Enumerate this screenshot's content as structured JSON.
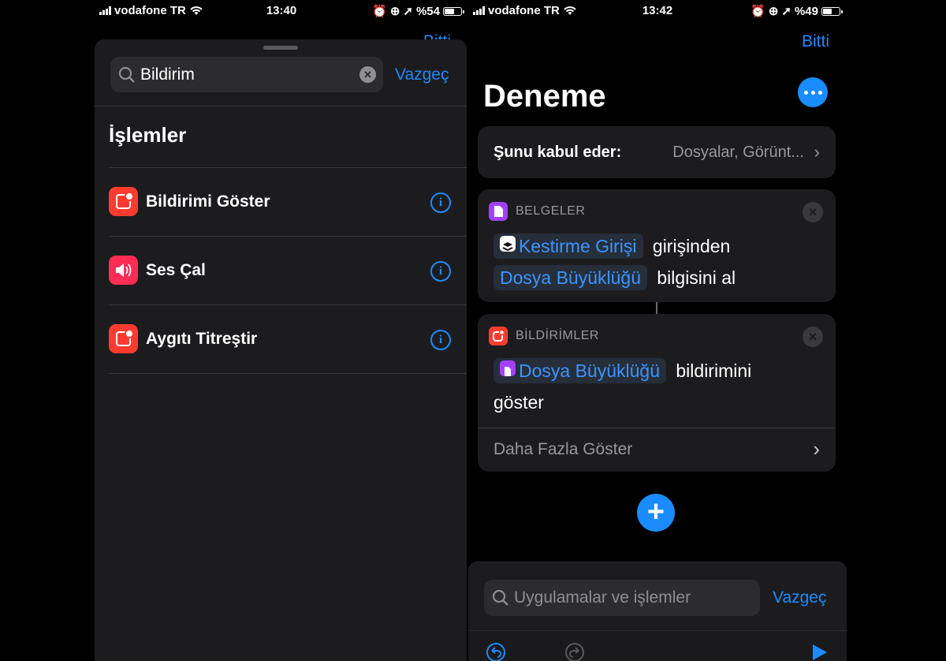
{
  "colors": {
    "accent": "#1a8cff",
    "notification_red": "#ff3b30",
    "sound_pink": "#ff2d55",
    "documents_purple": "#a440ff"
  },
  "left": {
    "status": {
      "carrier": "vodafone TR",
      "time": "13:40",
      "battery": "%54",
      "battery_level": 0.54
    },
    "top_right_partial": "Bitti",
    "search": {
      "value": "Bildirim",
      "cancel_label": "Vazgeç"
    },
    "section_title": "İşlemler",
    "actions": [
      {
        "label": "Bildirimi Göster",
        "icon": "notification-icon"
      },
      {
        "label": "Ses Çal",
        "icon": "speaker-icon"
      },
      {
        "label": "Aygıtı Titreştir",
        "icon": "notification-icon"
      }
    ]
  },
  "right": {
    "status": {
      "carrier": "vodafone TR",
      "time": "13:42",
      "battery": "%49",
      "battery_level": 0.49
    },
    "done_label": "Bitti",
    "title": "Deneme",
    "accepts": {
      "label": "Şunu kabul eder:",
      "value": "Dosyalar, Görünt..."
    },
    "action1": {
      "category": "BELGELER",
      "token1": "Kestirme Girişi",
      "text1": "girişinden",
      "token2": "Dosya Büyüklüğü",
      "text2": "bilgisini al"
    },
    "action2": {
      "category": "BİLDİRİMLER",
      "token1": "Dosya Büyüklüğü",
      "text1": "bildirimini",
      "text2": "göster",
      "show_more": "Daha Fazla Göster"
    },
    "add_label": "+",
    "bottom_search": {
      "placeholder": "Uygulamalar ve işlemler",
      "cancel_label": "Vazgeç"
    }
  }
}
